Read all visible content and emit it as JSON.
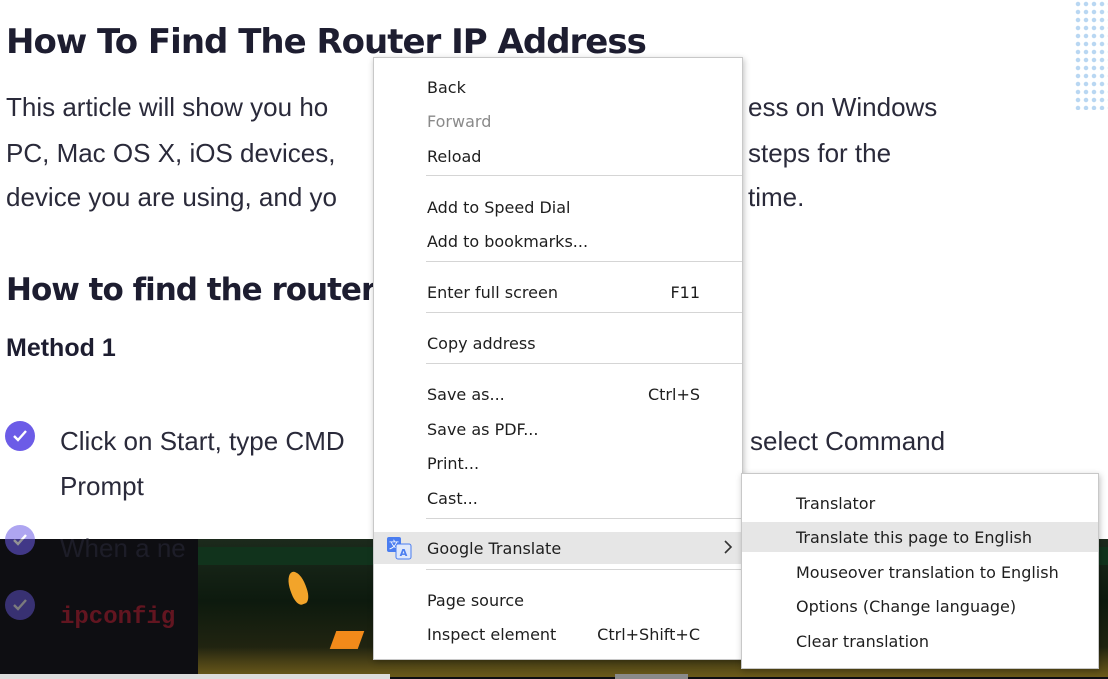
{
  "article": {
    "title": "How To Find The Router IP Address",
    "intro_lines": [
      "This article will show you ho",
      "PC, Mac OS X, iOS devices,",
      "device you are using, and yo"
    ],
    "intro_right": [
      "ess on Windows",
      "steps for the",
      "time."
    ],
    "section_heading": "How to find the router IP",
    "method_heading": "Method 1",
    "steps": [
      {
        "left": "Click on Start, type CMD",
        "right": "select Command"
      },
      {
        "left": "Prompt"
      },
      {
        "left": "When a ne"
      },
      {
        "left": "ipconfig"
      }
    ]
  },
  "context_menu": {
    "items": [
      {
        "label": "Back",
        "enabled": true
      },
      {
        "label": "Forward",
        "enabled": false
      },
      {
        "label": "Reload",
        "enabled": true
      },
      {
        "label": "Add to Speed Dial",
        "enabled": true
      },
      {
        "label": "Add to bookmarks...",
        "enabled": true
      },
      {
        "label": "Enter full screen",
        "shortcut": "F11",
        "enabled": true
      },
      {
        "label": "Copy address",
        "enabled": true
      },
      {
        "label": "Save as...",
        "shortcut": "Ctrl+S",
        "enabled": true
      },
      {
        "label": "Save as PDF...",
        "enabled": true
      },
      {
        "label": "Print...",
        "enabled": true
      },
      {
        "label": "Cast...",
        "enabled": true
      },
      {
        "label": "Google Translate",
        "icon": "google-translate-icon",
        "has_submenu": true,
        "enabled": true
      },
      {
        "label": "Page source",
        "enabled": true
      },
      {
        "label": "Inspect element",
        "shortcut": "Ctrl+Shift+C",
        "enabled": true
      }
    ]
  },
  "translate_submenu": {
    "items": [
      {
        "label": "Translator"
      },
      {
        "label": "Translate this page to English",
        "highlighted": true
      },
      {
        "label": "Mouseover translation to English"
      },
      {
        "label": "Options (Change language)"
      },
      {
        "label": "Clear translation"
      }
    ]
  },
  "colors": {
    "accent_check": "#6c5ce7",
    "menu_highlight": "#e6e6e6",
    "translate_icon_blue": "#4a7df0"
  }
}
